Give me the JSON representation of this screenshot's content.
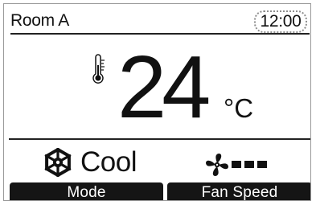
{
  "header": {
    "room_name": "Room A",
    "clock": "12:00"
  },
  "temperature": {
    "value": "24",
    "unit": "°C",
    "icon": "thermometer-icon"
  },
  "status": {
    "mode_label": "Cool",
    "mode_icon": "snowflake-icon",
    "fan_icon": "fan-icon",
    "fan_speed_level": 3
  },
  "softkeys": {
    "left_label": "Mode",
    "right_label": "Fan Speed"
  },
  "colors": {
    "foreground": "#111111",
    "background": "#ffffff",
    "softkey_bg": "#151515",
    "softkey_text": "#ffffff"
  }
}
